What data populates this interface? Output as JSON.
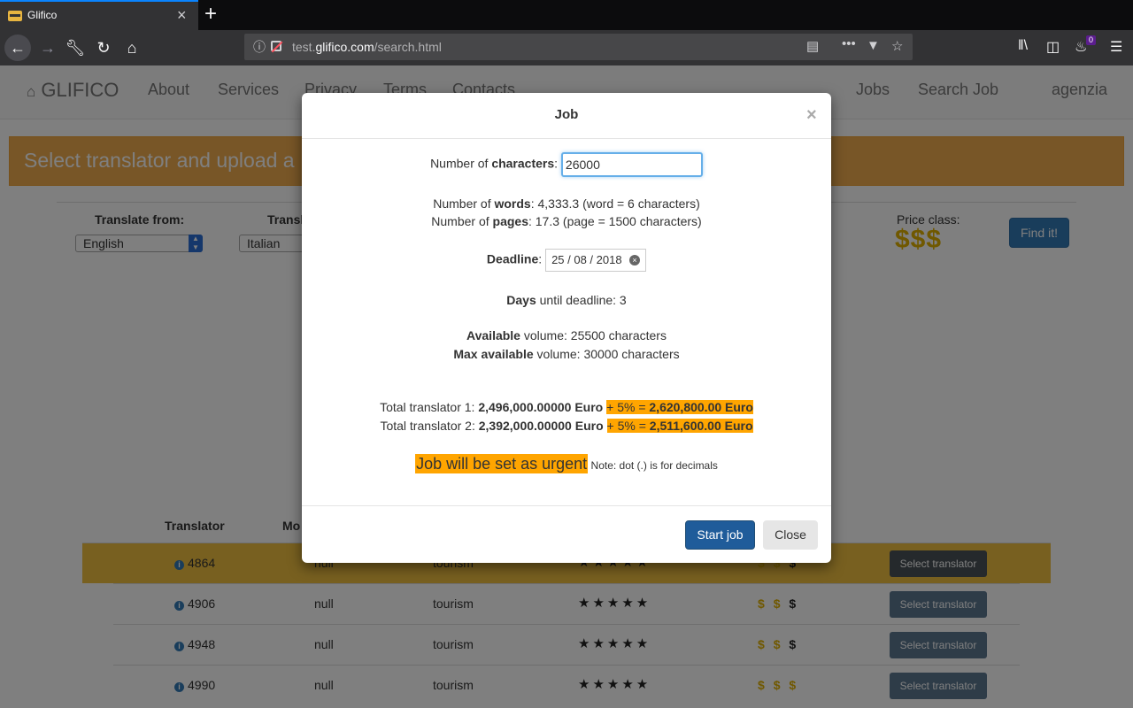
{
  "browser": {
    "tab_title": "Glifico",
    "tab_close": "×",
    "new_tab": "+",
    "url_prefix": "test.",
    "url_domain": "glifico.com",
    "url_path": "/search.html",
    "notification_count": "0"
  },
  "navbar": {
    "brand": "GLIFICO",
    "links": [
      "About",
      "Services",
      "Privacy",
      "Terms",
      "Contacts"
    ],
    "right_links": [
      "Jobs",
      "Search Job",
      "agenzia"
    ]
  },
  "banner": {
    "text": "Select translator and upload a"
  },
  "form": {
    "from_label": "Translate from:",
    "from_value": "English",
    "to_label": "Transl",
    "to_value": "Italian",
    "price_label": "Price class:",
    "price_value": "$$$",
    "find_button": "Find it!"
  },
  "table": {
    "headers": [
      "Translator",
      "Mo"
    ],
    "select_label": "Select translator",
    "rows": [
      {
        "id": "4864",
        "mother": "null",
        "field": "tourism",
        "stars": "★★★★★",
        "d1": "$",
        "d2": "$",
        "d3": "$"
      },
      {
        "id": "4906",
        "mother": "null",
        "field": "tourism",
        "stars": "★★★★★",
        "d1": "$",
        "d2": "$",
        "d3": "$"
      },
      {
        "id": "4948",
        "mother": "null",
        "field": "tourism",
        "stars": "★★★★★",
        "d1": "$",
        "d2": "$",
        "d3": "$"
      },
      {
        "id": "4990",
        "mother": "null",
        "field": "tourism",
        "stars": "★★★★★",
        "d1": "$",
        "d2": "$",
        "d3": "$"
      }
    ]
  },
  "modal": {
    "title": "Job",
    "close_x": "×",
    "chars_label_pre": "Number of ",
    "chars_label_bold": "characters",
    "chars_value": "26000",
    "words_pre": "Number of ",
    "words_bold": "words",
    "words_text": ": 4,333.3 (word = 6 characters)",
    "pages_pre": "Number of ",
    "pages_bold": "pages",
    "pages_text": ": 17.3 (page = 1500 characters)",
    "deadline_label": "Deadline",
    "deadline_value": "25 / 08 / 2018",
    "days_bold": "Days",
    "days_text": " until deadline: 3",
    "available_bold": "Available",
    "available_text": " volume: 25500 characters",
    "max_bold": "Max available",
    "max_text": " volume: 30000 characters",
    "total1_label": "Total translator 1: ",
    "total1_value": "2,496,000.00000 Euro",
    "total1_plus": "+ 5% = ",
    "total1_final": "2,620,800.00 Euro",
    "total2_label": "Total translator 2: ",
    "total2_value": "2,392,000.00000 Euro",
    "total2_plus": "+ 5% = ",
    "total2_final": "2,511,600.00 Euro",
    "urgent_text": "Job will be set as urgent",
    "note_text": " Note: dot (.) is for decimals",
    "start_button": "Start job",
    "close_button": "Close"
  }
}
